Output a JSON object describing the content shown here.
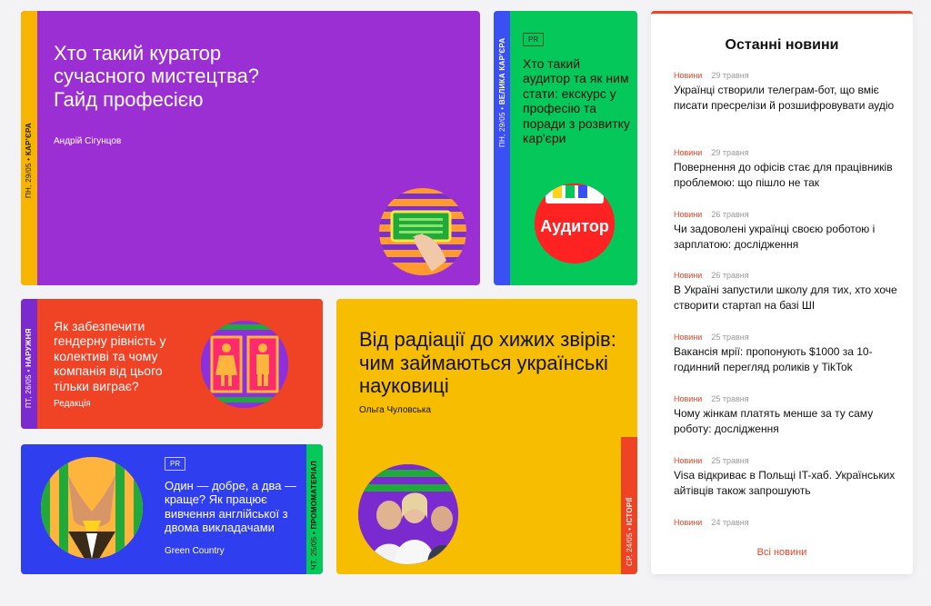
{
  "cards": [
    {
      "date": "ПН, 29/05",
      "category": "КАР'ЄРА",
      "title": "Хто такий куратор сучасного мистецтва? Гайд професією",
      "author": "Андрій Сігунцов"
    },
    {
      "date": "ПН, 29/05",
      "category": "ВЕЛИКА КАР'ЄРА",
      "badge": "PR",
      "title": "Хто такий аудитор та як ним стати: екскурс у професію та поради з розвитку кар'єри",
      "image_label": "Аудитор"
    },
    {
      "date": "ПТ, 26/05",
      "category": "НАРУЖНЯ",
      "title": "Як забезпечити гендерну рівність у колективі та чому компанія від цього тільки виграє?",
      "author": "Редакція"
    },
    {
      "date": "ЧТ, 25/05",
      "category": "ПРОМОМАТЕРІАЛ",
      "badge": "PR",
      "title": "Один — добре, а два — краще? Як працює вивчення англійської з двома викладачами",
      "author": "Green Country"
    },
    {
      "date": "СР, 24/05",
      "category": "ІСТОРІЇ",
      "title": "Від радіації до хижих звірів: чим займаються українські науковиці",
      "author": "Ольга Чуловська"
    }
  ],
  "news": {
    "heading": "Останні новини",
    "items": [
      {
        "category": "Новини",
        "date": "29 травня",
        "title": "Українці створили телеграм-бот, що вміє писати пресрелізи й розшифровувати аудіо"
      },
      {
        "category": "Новини",
        "date": "29 травня",
        "title": "Повернення до офісів стає для працівників проблемою: що пішло не так"
      },
      {
        "category": "Новини",
        "date": "26 травня",
        "title": "Чи задоволені українці своєю роботою і зарплатою: дослідження"
      },
      {
        "category": "Новини",
        "date": "26 травня",
        "title": "В Україні запустили школу для тих, хто хоче створити стартап на базі ШІ"
      },
      {
        "category": "Новини",
        "date": "25 травня",
        "title": "Вакансія мрії: пропонують $1000 за 10-годинний перегляд роликів у TikTok"
      },
      {
        "category": "Новини",
        "date": "25 травня",
        "title": "Чому жінкам платять менше за ту саму роботу: дослідження"
      },
      {
        "category": "Новини",
        "date": "25 травня",
        "title": "Visa відкриває в Польщі IT-хаб. Українських айтівців також запрошують"
      },
      {
        "category": "Новини",
        "date": "24 травня",
        "title": ""
      }
    ],
    "all_link": "Всі новини"
  },
  "colors": {
    "purple": "#9b2fd4",
    "green": "#05c85a",
    "red": "#f04325",
    "blue": "#2f3ff0",
    "yellow": "#f7bd00"
  }
}
